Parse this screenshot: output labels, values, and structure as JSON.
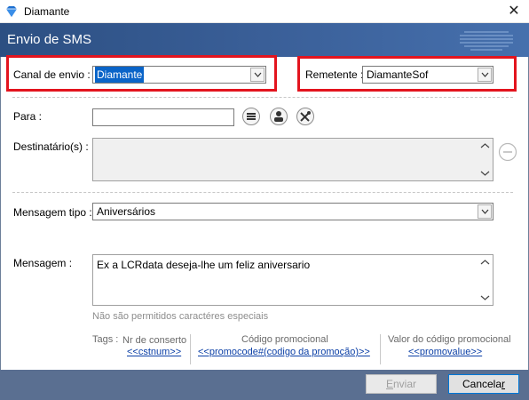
{
  "window": {
    "title": "Diamante",
    "close_glyph": "✕",
    "icon": "diamond-icon"
  },
  "header": {
    "title": "Envio de SMS"
  },
  "form": {
    "canal_label": "Canal de envio :",
    "canal_value": "Diamante",
    "remetente_label": "Remetente :",
    "remetente_value": "DiamanteSof",
    "para_label": "Para :",
    "para_value": "",
    "destinatarios_label": "Destinatário(s) :",
    "mensagem_tipo_label": "Mensagem tipo :",
    "mensagem_tipo_value": "Aniversários",
    "mensagem_label": "Mensagem :",
    "mensagem_value": "Ex a LCRdata deseja-lhe um feliz aniversario",
    "note": "Não são permitidos caractéres especiais"
  },
  "tags": {
    "label": "Tags :",
    "items": [
      {
        "title": "Nr de conserto",
        "link": "<<cstnum>>"
      },
      {
        "title": "Código promocional",
        "link": "<<promocode#(codigo da promoção)>>"
      },
      {
        "title": "Valor do código promocional",
        "link": "<<promovalue>>"
      }
    ]
  },
  "buttons": {
    "enviar_first": "E",
    "enviar_rest": "nviar",
    "cancelar_first": "Cancela",
    "cancelar_rest": "r"
  },
  "colors": {
    "header": "#3a5f98",
    "highlight": "#e3141e",
    "selection": "#0a64c8",
    "link": "#0b3fa6"
  }
}
